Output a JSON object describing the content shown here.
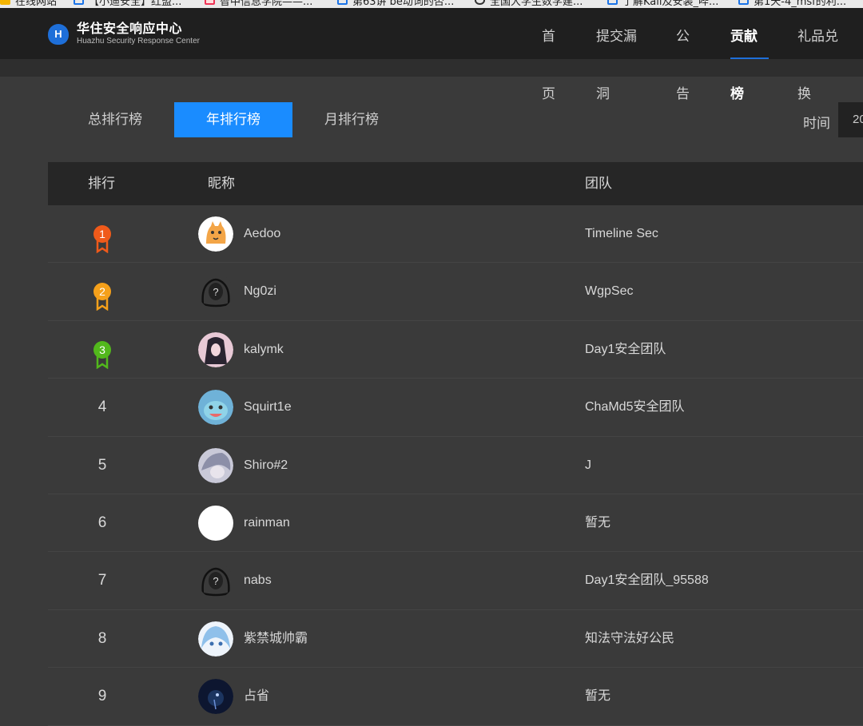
{
  "bookmarks": [
    {
      "label": "在线网站",
      "icon": "yellow-folder-icon"
    },
    {
      "label": "【小迪安全】红盟...",
      "icon": "web-page-icon"
    },
    {
      "label": "智中信息学院——...",
      "icon": "pink-page-icon"
    },
    {
      "label": "第63讲 be动词的否...",
      "icon": "web-page-icon"
    },
    {
      "label": "全国大学生数学建...",
      "icon": "globe-icon"
    },
    {
      "label": "了解Kali及安装_哔...",
      "icon": "web-page-icon"
    },
    {
      "label": "第1天-4_msf的利...",
      "icon": "web-page-icon"
    }
  ],
  "header": {
    "logo_letter": "H",
    "brand_cn": "华住安全响应中心",
    "brand_en": "Huazhu Security Response Center",
    "nav": [
      {
        "label": "首页",
        "active": false
      },
      {
        "label": "提交漏洞",
        "active": false
      },
      {
        "label": "公告",
        "active": false
      },
      {
        "label": "贡献榜",
        "active": true
      },
      {
        "label": "礼品兑换",
        "active": false
      }
    ]
  },
  "tabs": [
    {
      "label": "总排行榜",
      "active": false
    },
    {
      "label": "年排行榜",
      "active": true
    },
    {
      "label": "月排行榜",
      "active": false
    }
  ],
  "filter": {
    "time_label": "时间",
    "time_value": "20"
  },
  "table": {
    "columns": {
      "rank": "排行",
      "nickname": "昵称",
      "team": "团队"
    },
    "rows": [
      {
        "rank": "1",
        "nickname": "Aedoo",
        "team": "Timeline Sec",
        "medal": "#f05a1a",
        "avatar": "cat-avatar"
      },
      {
        "rank": "2",
        "nickname": "Ng0zi",
        "team": "WgpSec",
        "medal": "#f5a01a",
        "avatar": "default-hooded-avatar"
      },
      {
        "rank": "3",
        "nickname": "kalymk",
        "team": "Day1安全团队",
        "medal": "#52b81c",
        "avatar": "anime-girl-avatar"
      },
      {
        "rank": "4",
        "nickname": "Squirt1e",
        "team": "ChaMd5安全团队",
        "avatar": "squirtle-avatar"
      },
      {
        "rank": "5",
        "nickname": "Shiro#2",
        "team": "J",
        "avatar": "anime-boy-avatar"
      },
      {
        "rank": "6",
        "nickname": "rainman",
        "team": "暂无",
        "avatar": "blank-avatar"
      },
      {
        "rank": "7",
        "nickname": "nabs",
        "team": "Day1安全团队_95588",
        "avatar": "default-hooded-avatar"
      },
      {
        "rank": "8",
        "nickname": "紫禁城帅霸",
        "team": "知法守法好公民",
        "avatar": "blue-hair-avatar"
      },
      {
        "rank": "9",
        "nickname": "占省",
        "team": "暂无",
        "avatar": "dark-space-avatar"
      }
    ]
  }
}
